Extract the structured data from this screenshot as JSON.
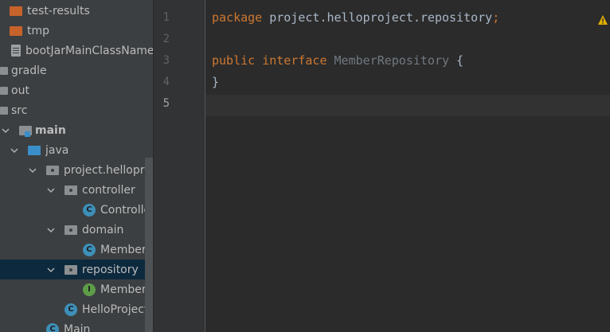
{
  "project_tree": {
    "items": [
      {
        "label": "test-results",
        "icon": "folder-orange"
      },
      {
        "label": "tmp",
        "icon": "folder-orange"
      },
      {
        "label": "bootJarMainClassName",
        "icon": "file"
      },
      {
        "label": "gradle",
        "icon": "folder-gray"
      },
      {
        "label": "out",
        "icon": "folder-gray"
      },
      {
        "label": "src",
        "icon": "folder-gray"
      },
      {
        "label": "main",
        "icon": "folder-source"
      },
      {
        "label": "java",
        "icon": "folder-blue"
      },
      {
        "label": "project.helloproje",
        "icon": "package"
      },
      {
        "label": "controller",
        "icon": "package"
      },
      {
        "label": "Controller",
        "icon": "class"
      },
      {
        "label": "domain",
        "icon": "package"
      },
      {
        "label": "Member",
        "icon": "class"
      },
      {
        "label": "repository",
        "icon": "package",
        "selected": true
      },
      {
        "label": "MemberRe",
        "icon": "interface"
      },
      {
        "label": "HelloProjectA",
        "icon": "class"
      },
      {
        "label": "Main",
        "icon": "class"
      }
    ]
  },
  "editor": {
    "line_numbers": [
      "1",
      "2",
      "3",
      "4",
      "5"
    ],
    "current_line": "5",
    "lines": {
      "l1": {
        "kw": "package",
        "rest": " project.helloproject.repository",
        "semi": ";"
      },
      "l3": {
        "kw1": "public",
        "kw2": "interface",
        "name": "MemberRepository",
        "brace": " {"
      },
      "l4": {
        "text": "}"
      }
    },
    "warning_icon": "warning-icon"
  },
  "colors": {
    "keyword": "#cc7832",
    "text": "#a9b7c6",
    "selection": "#0d293e",
    "class_badge": "#3d8fb8",
    "interface_badge": "#5e9d48"
  }
}
